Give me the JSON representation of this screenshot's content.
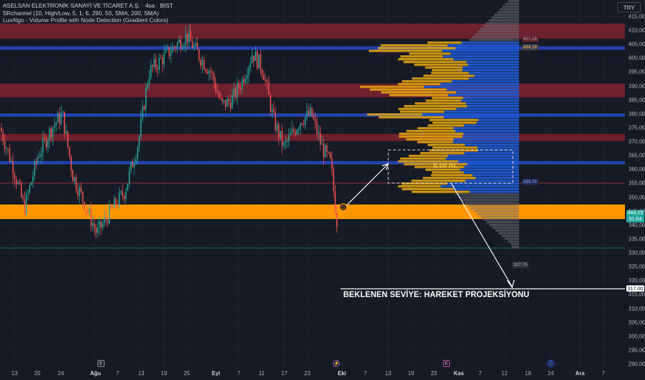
{
  "legend": {
    "title": "ASELSAN ELEKTRONİK SANAYİ VE TİCARET A.Ş. · 4sa · BIST",
    "indicator1": "SRchannel (10, High/Low, 5, 1, 6, 290, 50, SMA, 200, SMA)",
    "indicator2": "LuxAlgo - Volume Profile with Node Detection (Gradient Colors)"
  },
  "currency_button": "TRY",
  "price_axis": {
    "ticks": [
      "415,00",
      "410,00",
      "405,00",
      "400,00",
      "395,00",
      "390,00",
      "385,00",
      "380,00",
      "375,00",
      "370,00",
      "365,00",
      "360,00",
      "355,00",
      "350,00",
      "345,00",
      "340,00",
      "335,00",
      "330,00",
      "325,00",
      "320,00",
      "315,00",
      "310,00",
      "305,00",
      "300,00",
      "295,00",
      "290,00"
    ],
    "current_price": "344,25",
    "countdown": "01:54",
    "target_label": "317,00"
  },
  "time_axis": {
    "labels": [
      {
        "text": "13",
        "bold": false
      },
      {
        "text": "20",
        "bold": false
      },
      {
        "text": "24",
        "bold": false
      },
      {
        "text": "Ağu",
        "bold": true
      },
      {
        "text": "7",
        "bold": false
      },
      {
        "text": "13",
        "bold": false
      },
      {
        "text": "19",
        "bold": false
      },
      {
        "text": "25",
        "bold": false
      },
      {
        "text": "Eyl",
        "bold": true
      },
      {
        "text": "7",
        "bold": false
      },
      {
        "text": "11",
        "bold": false
      },
      {
        "text": "17",
        "bold": false
      },
      {
        "text": "23",
        "bold": false
      },
      {
        "text": "Eki",
        "bold": true
      },
      {
        "text": "7",
        "bold": false
      },
      {
        "text": "13",
        "bold": false
      },
      {
        "text": "19",
        "bold": false
      },
      {
        "text": "23",
        "bold": false
      },
      {
        "text": "Kas",
        "bold": true
      },
      {
        "text": "7",
        "bold": false
      },
      {
        "text": "12",
        "bold": false
      },
      {
        "text": "18",
        "bold": false
      },
      {
        "text": "24",
        "bold": false
      },
      {
        "text": "Ara",
        "bold": true
      },
      {
        "text": "7",
        "bold": false
      }
    ],
    "events": [
      "E",
      "E",
      "D"
    ]
  },
  "profile_tags": {
    "top": "407,28",
    "poc": "404,28",
    "mid": "355,75",
    "low": "327,75"
  },
  "annotations": {
    "zone_label": "İLGİ AL",
    "projection_text": "BEKLENEN SEVİYE: HAREKET PROJEKSİYONU",
    "marker_letter": "D"
  },
  "colors": {
    "background": "#161a25",
    "bull": "#26a69a",
    "bear": "#ef5350",
    "resistance_zone": "#8b2430",
    "support_line": "#2340a8",
    "support_zone": "#ff9800",
    "profile_yellow": "#e8a810",
    "profile_blue": "#1e5bd6",
    "profile_gray": "#6b6f78"
  }
}
